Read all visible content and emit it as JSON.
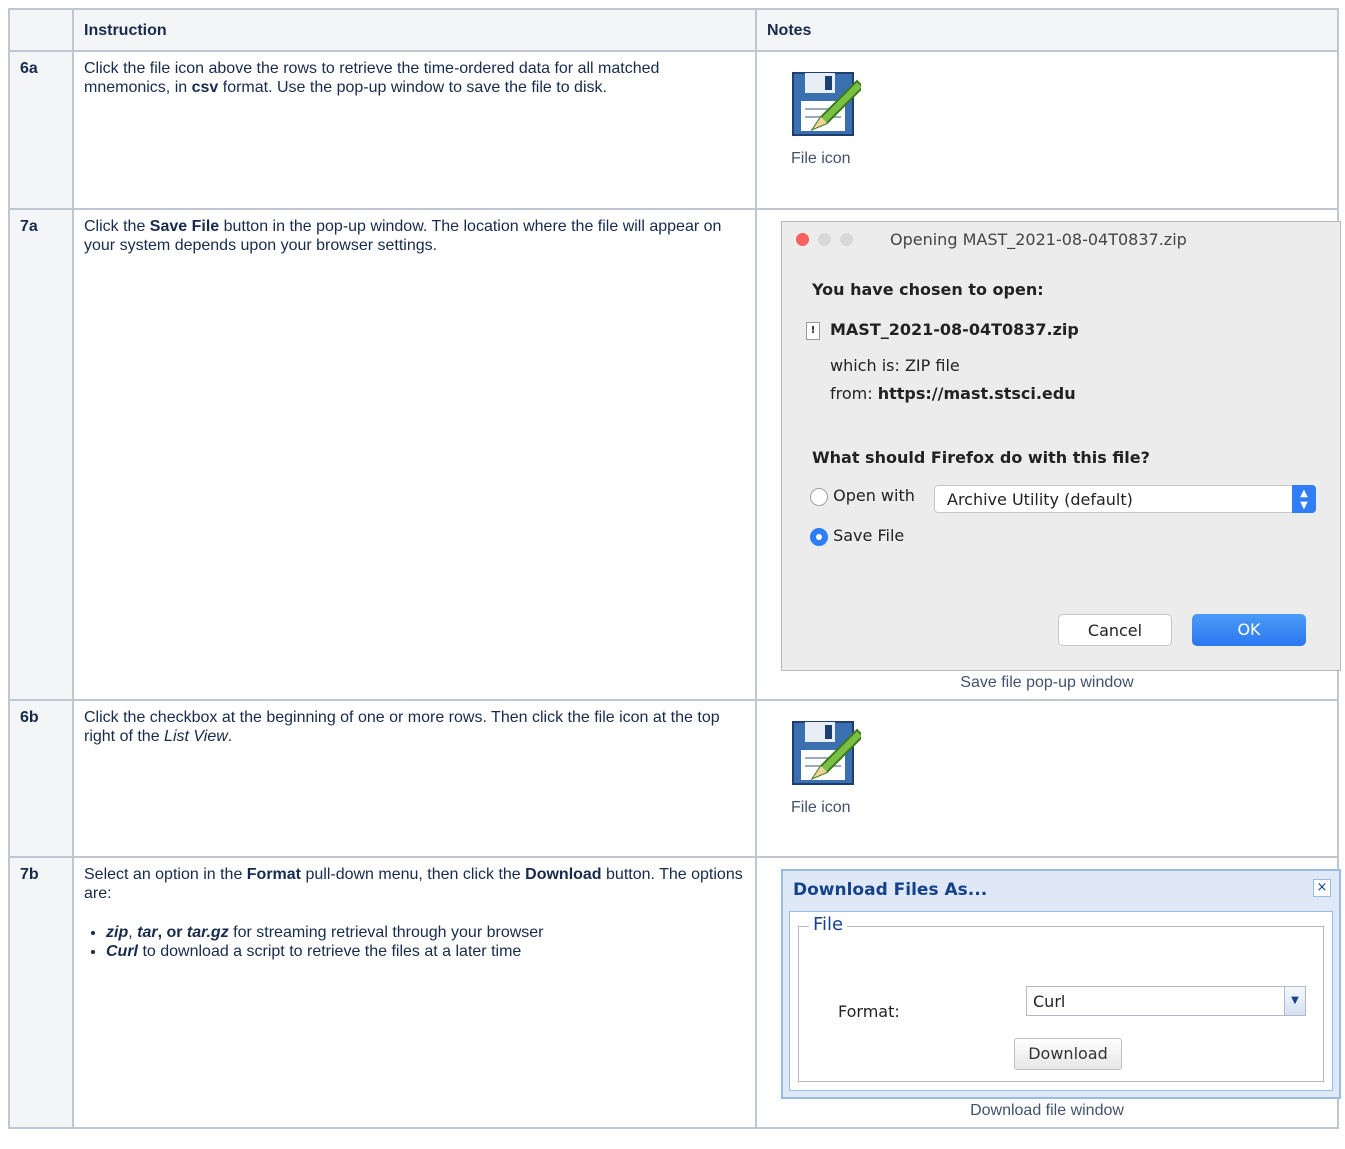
{
  "table": {
    "headers": {
      "num": "",
      "instruction": "Instruction",
      "notes": "Notes"
    }
  },
  "rows": {
    "r6a": {
      "num": "6a",
      "t1": "Click the file icon above the rows to retrieve the time-ordered data for all matched mnemonics, in ",
      "b1": "csv",
      "t2": " format. Use the pop-up window to save the file to disk.",
      "caption": "File icon"
    },
    "r7a": {
      "num": "7a",
      "t1": "Click the ",
      "b1": "Save File",
      "t2": " button in the pop-up window. The location where the file will appear on your system depends upon your browser settings.",
      "caption": "Save file pop-up window"
    },
    "r6b": {
      "num": "6b",
      "t1": "Click the checkbox at the beginning of one or more rows. Then click the file icon at the top right of the ",
      "i1": "List View",
      "t2": ".",
      "caption": "File icon"
    },
    "r7b": {
      "num": "7b",
      "t1": "Select an option in the ",
      "b1": "Format",
      "t2": " pull-down menu, then click the ",
      "b2": "Download",
      "t3": " button. The options are:",
      "opt1": {
        "zip": "zip",
        "sep1": ", ",
        "tar": "tar",
        "or": ", or ",
        "targz": "tar.gz",
        "rest": " for streaming retrieval through your browser"
      },
      "opt2": {
        "curl": "Curl",
        "rest": " to download a script to retrieve the files at a later time"
      },
      "caption": "Download file window"
    }
  },
  "mac_dialog": {
    "title": "Opening MAST_2021-08-04T0837.zip",
    "chosen": "You have chosen to open:",
    "filename": "MAST_2021-08-04T0837.zip",
    "which_label": "which is:",
    "which_value": "ZIP file",
    "from_label": "from:",
    "from_value": "https://mast.stsci.edu",
    "question": "What should Firefox do with this file?",
    "open_with": "Open with",
    "app": "Archive Utility (default)",
    "save_file": "Save File",
    "cancel": "Cancel",
    "ok": "OK",
    "colors": {
      "close": "#fc605c",
      "min": "#d8d8d8",
      "max": "#d8d8d8",
      "accent": "#2f7ef5"
    }
  },
  "ext_dialog": {
    "title": "Download Files As...",
    "close": "×",
    "legend": "File",
    "format_label": "Format:",
    "format_value": "Curl",
    "download": "Download"
  }
}
